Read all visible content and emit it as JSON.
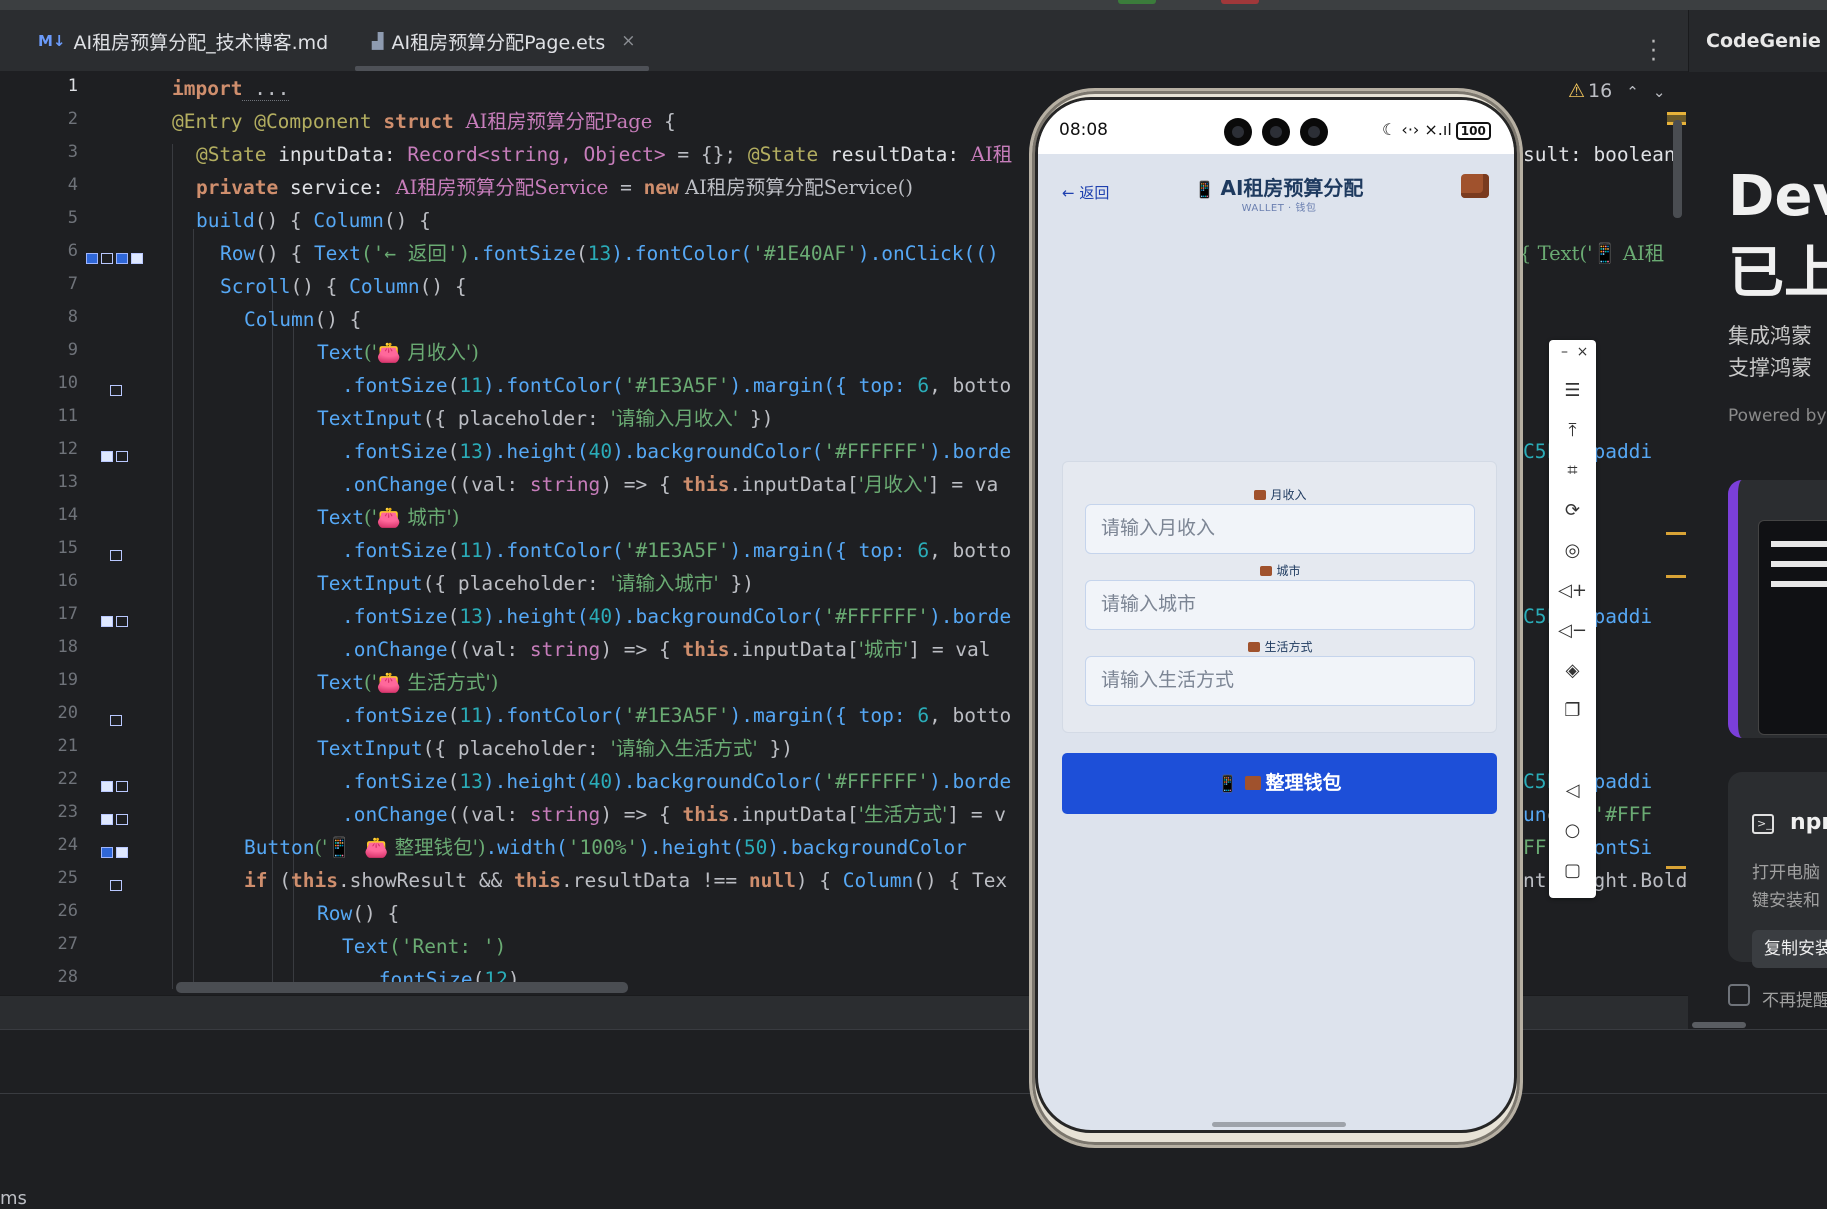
{
  "tabs": [
    {
      "icon": "M↓",
      "label": "AI租房预算分配_技术博客.md"
    },
    {
      "icon": "▟",
      "label": "AI租房预算分配Page.ets",
      "close": "×"
    }
  ],
  "right_panel_title": "CodeGenie",
  "warnings": {
    "count": "16"
  },
  "line_numbers": [
    "1",
    "2",
    "3",
    "4",
    "5",
    "6",
    "7",
    "8",
    "9",
    "10",
    "11",
    "12",
    "13",
    "14",
    "15",
    "16",
    "17",
    "18",
    "19",
    "20",
    "21",
    "22",
    "23",
    "24",
    "25",
    "26",
    "27",
    "28"
  ],
  "code": {
    "l1": {
      "kw": "import",
      "rest": " ..."
    },
    "l2": {
      "a": "@Entry",
      "b": "@Component",
      "c": "struct",
      "d": "AI租房预算分配Page",
      "e": " {"
    },
    "l3": {
      "a": "@State",
      "b": " inputData: ",
      "c": "Record",
      "d": "<string, Object>",
      "e": " = {}; ",
      "f": "@State",
      "g": " resultData: ",
      "h": "AI租"
    },
    "l4": {
      "a": "private",
      "b": " service: ",
      "c": "AI租房预算分配Service",
      "d": " = ",
      "e": "new",
      "f": " AI租房预算分配Service()"
    },
    "l5": {
      "a": "build",
      "b": "() { ",
      "c": "Column",
      "d": "() {"
    },
    "l6": {
      "a": "Row",
      "b": "() { ",
      "c": "Text",
      "d": "('← 返回')",
      "e": ".fontSize",
      "f": "(",
      "g": "13",
      "h": ").fontColor(",
      "i": "'#1E40AF'",
      "j": ").onClick(()"
    },
    "l7": {
      "a": "Scroll",
      "b": "() { ",
      "c": "Column",
      "d": "() {"
    },
    "l8": {
      "a": "Column",
      "b": "() {"
    },
    "l9": {
      "a": "Text",
      "b": "('👛 月收入')"
    },
    "l10": {
      "a": ".fontSize",
      "b": "(",
      "c": "11",
      "d": ").fontColor(",
      "e": "'#1E3A5F'",
      "f": ").margin({ top: ",
      "g": "6",
      "h": ", botto"
    },
    "l11": {
      "a": "TextInput",
      "b": "({ placeholder: ",
      "c": "'请输入月收入'",
      "d": " })"
    },
    "l12": {
      "a": ".fontSize",
      "b": "(",
      "c": "13",
      "d": ").height(",
      "e": "40",
      "f": ").backgroundColor(",
      "g": "'#FFFFFF'",
      "h": ").borde"
    },
    "l13": {
      "a": ".onChange",
      "b": "((val: ",
      "c": "string",
      "d": ") => { ",
      "e": "this",
      "f": ".inputData[",
      "g": "'月收入'",
      "h": "] = va"
    },
    "l14": {
      "a": "Text",
      "b": "('👛 城市')"
    },
    "l15": {
      "a": ".fontSize",
      "b": "(",
      "c": "11",
      "d": ").fontColor(",
      "e": "'#1E3A5F'",
      "f": ").margin({ top: ",
      "g": "6",
      "h": ", botto"
    },
    "l16": {
      "a": "TextInput",
      "b": "({ placeholder: ",
      "c": "'请输入城市'",
      "d": " })"
    },
    "l17": {
      "a": ".fontSize",
      "b": "(",
      "c": "13",
      "d": ").height(",
      "e": "40",
      "f": ").backgroundColor(",
      "g": "'#FFFFFF'",
      "h": ").borde"
    },
    "l18": {
      "a": ".onChange",
      "b": "((val: ",
      "c": "string",
      "d": ") => { ",
      "e": "this",
      "f": ".inputData[",
      "g": "'城市'",
      "h": "] = val"
    },
    "l19": {
      "a": "Text",
      "b": "('👛 生活方式')"
    },
    "l20": {
      "a": ".fontSize",
      "b": "(",
      "c": "11",
      "d": ").fontColor(",
      "e": "'#1E3A5F'",
      "f": ").margin({ top: ",
      "g": "6",
      "h": ", botto"
    },
    "l21": {
      "a": "TextInput",
      "b": "({ placeholder: ",
      "c": "'请输入生活方式'",
      "d": " })"
    },
    "l22": {
      "a": ".fontSize",
      "b": "(",
      "c": "13",
      "d": ").height(",
      "e": "40",
      "f": ").backgroundColor(",
      "g": "'#FFFFFF'",
      "h": ").borde"
    },
    "l23": {
      "a": ".onChange",
      "b": "((val: ",
      "c": "string",
      "d": ") => { ",
      "e": "this",
      "f": ".inputData[",
      "g": "'生活方式'",
      "h": "] = v"
    },
    "l24": {
      "a": "Button",
      "b": "('📱  👛 整理钱包')",
      "c": ".width(",
      "d": "'100%'",
      "e": ").height(",
      "f": "50",
      "g": ").backgroundColor"
    },
    "l25": {
      "a": "if",
      "b": " (",
      "c": "this",
      "d": ".showResult && ",
      "e": "this",
      "f": ".resultData !== ",
      "g": "null",
      "h": ") { ",
      "i": "Column",
      "j": "() { Tex"
    },
    "l26": {
      "a": "Row",
      "b": "() {"
    },
    "l27": {
      "a": "Text",
      "b": "('Rent: ')"
    },
    "l28": {
      "a": ".fontSize",
      "b": "(",
      "c": "12",
      "d": ")"
    }
  },
  "code_right": {
    "r3": "sult: boolean",
    "r6": "{ Text('📱 AI租",
    "r12": ").paddi",
    "r17": ").paddi",
    "r22": ").paddi",
    "r23": "or('#FFF",
    "r24": ".fontSi",
    "r25": "ht.Bold)"
  },
  "phone": {
    "time": "08:08",
    "battery": "100",
    "status_icons": "☾ ‹·› ×.ıl",
    "back": "← 返回",
    "title": "AI租房预算分配",
    "title_icon": "📱",
    "subtitle": "WALLET · 钱包",
    "fields": [
      {
        "label": "月收入",
        "placeholder": "请输入月收入"
      },
      {
        "label": "城市",
        "placeholder": "请输入城市"
      },
      {
        "label": "生活方式",
        "placeholder": "请输入生活方式"
      }
    ],
    "button_label": "整理钱包",
    "button_icon": "📱"
  },
  "toolbar_icons": [
    "minimize-icon",
    "close-icon",
    "menu-icon",
    "pin-top-icon",
    "crop-icon",
    "rotate-icon",
    "screenshot-icon",
    "volume-up-icon",
    "volume-down-icon",
    "shake-icon",
    "multi-window-icon",
    "back-triangle-icon",
    "home-circle-icon",
    "recent-square-icon"
  ],
  "codegenie": {
    "hero1": "Dev",
    "hero2": "已上",
    "desc1": "集成鸿蒙",
    "desc2": "支撑鸿蒙",
    "powered": "Powered by",
    "npm": "npm",
    "text1": "打开电脑",
    "text2": "键安装和",
    "copy": "复制安装",
    "noremind": "不再提醒"
  },
  "bottom_text": "ms",
  "colors": {
    "editor_bg": "#1e1f22",
    "keyword": "#cf8e6d",
    "annotation": "#b3ae60",
    "string": "#6aab73",
    "function": "#56a8f5",
    "accent_blue": "#1d4fd8"
  }
}
